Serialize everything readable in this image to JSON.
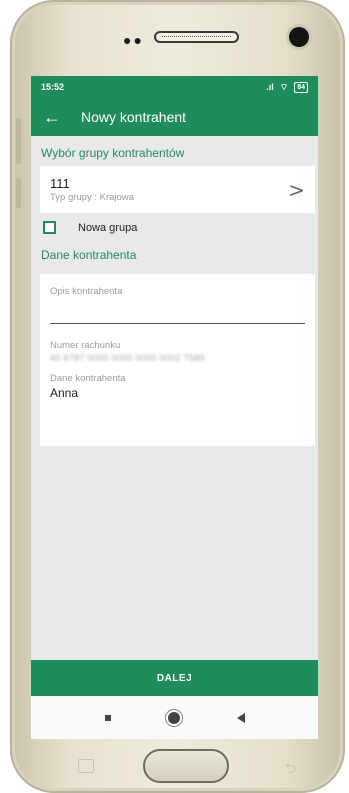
{
  "status": {
    "time": "15:52",
    "signal_icon": "signal-icon",
    "wifi_icon": "wifi-icon",
    "battery": "84"
  },
  "appbar": {
    "title": "Nowy kontrahent",
    "back_icon": "arrow-left-icon"
  },
  "group_section": {
    "title": "Wybór grupy kontrahentów",
    "group_number": "111",
    "group_type": "Typ grupy : Krajowa",
    "new_group_label": "Nowa grupa"
  },
  "details_section": {
    "title": "Dane kontrahenta",
    "description_label": "Opis kontrahenta",
    "account_label": "Numer rachunku",
    "account_value": "40 8787 0000 0000 0000 0002 7589",
    "name_label": "Dane kontrahenta",
    "name_value": "Anna"
  },
  "actions": {
    "next_label": "DALEJ"
  },
  "colors": {
    "brand_green": "#1f8c5c",
    "background": "#e9e9e9"
  }
}
